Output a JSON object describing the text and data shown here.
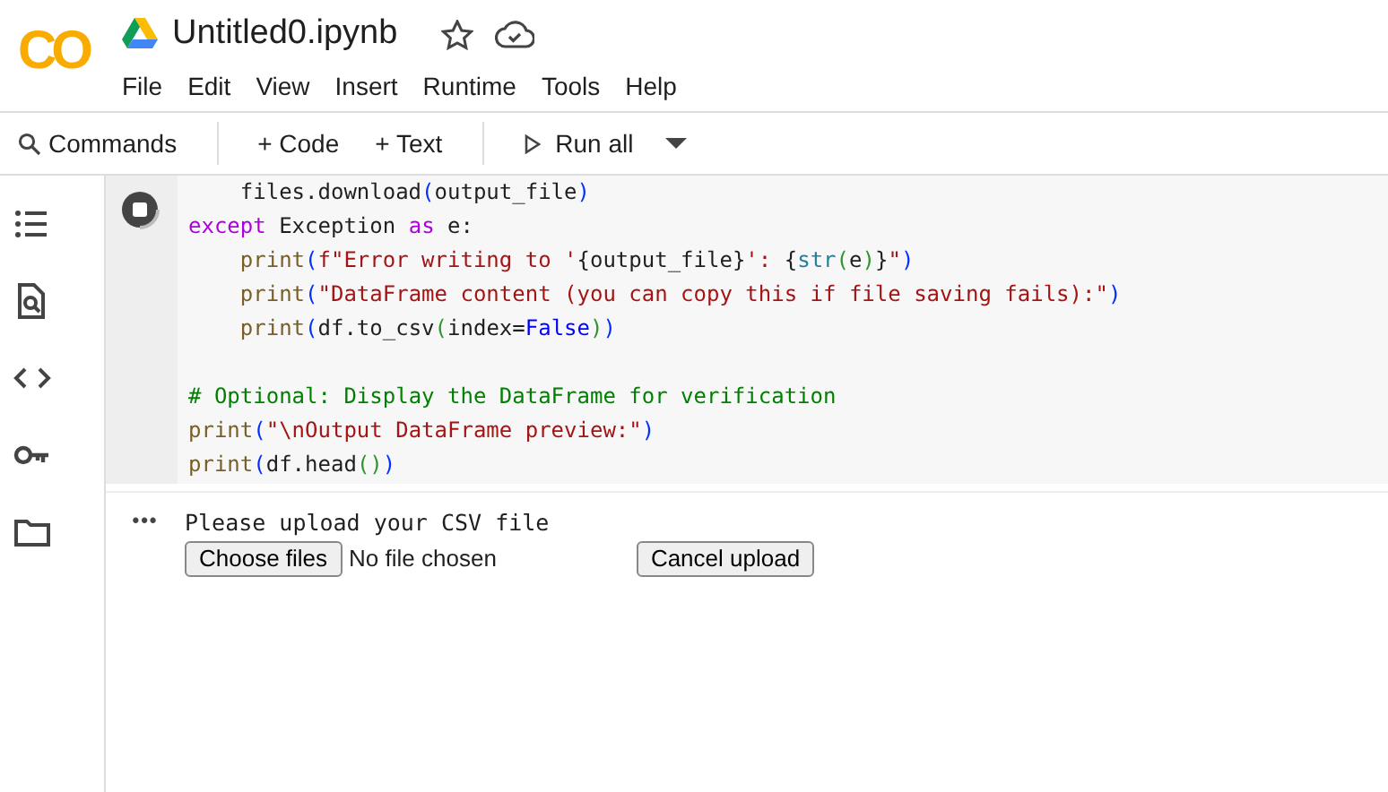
{
  "header": {
    "logo": "CO",
    "title": "Untitled0.ipynb",
    "starred": false,
    "menu": [
      "File",
      "Edit",
      "View",
      "Insert",
      "Runtime",
      "Tools",
      "Help"
    ]
  },
  "toolbar": {
    "commands": "Commands",
    "add_code": "+ Code",
    "add_text": "+ Text",
    "run_all": "Run all"
  },
  "sidebar": {
    "icons": [
      {
        "kind": "toc"
      },
      {
        "kind": "find"
      },
      {
        "kind": "code"
      },
      {
        "kind": "key"
      },
      {
        "kind": "folder"
      }
    ]
  },
  "cell": {
    "running": true,
    "lines": [
      {
        "indented": true,
        "tokens": [
          {
            "kind": "plain",
            "t": "files.download"
          },
          {
            "kind": "paren",
            "t": "("
          },
          {
            "kind": "plain",
            "t": "output_file"
          },
          {
            "kind": "paren",
            "t": ")"
          }
        ]
      },
      {
        "indented": false,
        "tokens": [
          {
            "kind": "kw",
            "t": "except"
          },
          {
            "kind": "plain",
            "t": " Exception "
          },
          {
            "kind": "kw",
            "t": "as"
          },
          {
            "kind": "plain",
            "t": " e:"
          }
        ]
      },
      {
        "indented": true,
        "tokens": [
          {
            "kind": "fn",
            "t": "print"
          },
          {
            "kind": "paren",
            "t": "("
          },
          {
            "kind": "str",
            "t": "f\"Error writing to '"
          },
          {
            "kind": "plain",
            "t": "{output_file}"
          },
          {
            "kind": "str",
            "t": "': "
          },
          {
            "kind": "plain",
            "t": "{"
          },
          {
            "kind": "builtin",
            "t": "str"
          },
          {
            "kind": "paren2",
            "t": "("
          },
          {
            "kind": "plain",
            "t": "e"
          },
          {
            "kind": "paren2",
            "t": ")"
          },
          {
            "kind": "plain",
            "t": "}"
          },
          {
            "kind": "str",
            "t": "\""
          },
          {
            "kind": "paren",
            "t": ")"
          }
        ]
      },
      {
        "indented": true,
        "tokens": [
          {
            "kind": "fn",
            "t": "print"
          },
          {
            "kind": "paren",
            "t": "("
          },
          {
            "kind": "str",
            "t": "\"DataFrame content (you can copy this if file saving fails):\""
          },
          {
            "kind": "paren",
            "t": ")"
          }
        ]
      },
      {
        "indented": true,
        "tokens": [
          {
            "kind": "fn",
            "t": "print"
          },
          {
            "kind": "paren",
            "t": "("
          },
          {
            "kind": "plain",
            "t": "df.to_csv"
          },
          {
            "kind": "paren2",
            "t": "("
          },
          {
            "kind": "plain",
            "t": "index="
          },
          {
            "kind": "const",
            "t": "False"
          },
          {
            "kind": "paren2",
            "t": ")"
          },
          {
            "kind": "paren",
            "t": ")"
          }
        ]
      },
      {
        "indented": false,
        "blank_before": true,
        "tokens": [
          {
            "kind": "com",
            "t": "# Optional: Display the DataFrame for verification"
          }
        ]
      },
      {
        "indented": false,
        "tokens": [
          {
            "kind": "fn",
            "t": "print"
          },
          {
            "kind": "paren",
            "t": "("
          },
          {
            "kind": "str",
            "t": "\"\\nOutput DataFrame preview:\""
          },
          {
            "kind": "paren",
            "t": ")"
          }
        ]
      },
      {
        "indented": false,
        "tokens": [
          {
            "kind": "fn",
            "t": "print"
          },
          {
            "kind": "paren",
            "t": "("
          },
          {
            "kind": "plain",
            "t": "df.head"
          },
          {
            "kind": "paren2",
            "t": "()"
          },
          {
            "kind": "paren",
            "t": ")"
          }
        ]
      }
    ]
  },
  "output": {
    "menu": "•••",
    "message": "Please upload your CSV file",
    "choose_button": "Choose files",
    "file_status": "No file chosen",
    "cancel_button": "Cancel upload"
  }
}
